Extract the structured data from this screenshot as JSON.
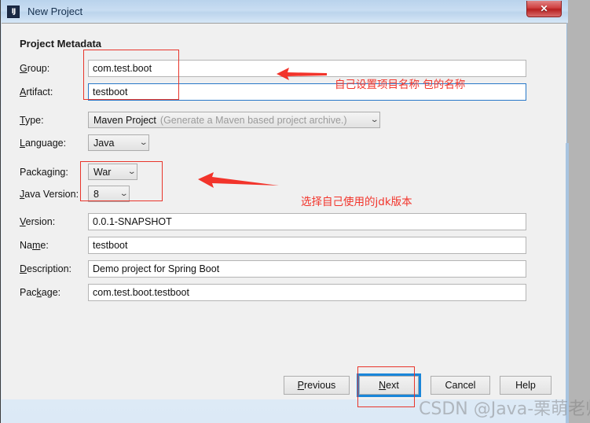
{
  "window": {
    "title": "New Project",
    "app_icon": "IJ",
    "close_label": "✕"
  },
  "dialog": {
    "section_title": "Project Metadata"
  },
  "fields": {
    "group": {
      "label_pre": "G",
      "label_mnemonic": "",
      "label": "Group:",
      "value": "com.test.boot"
    },
    "artifact": {
      "label": "Artifact:",
      "value": "testboot"
    },
    "type": {
      "label": "Type:",
      "value": "Maven Project",
      "hint": "(Generate a Maven based project archive.)"
    },
    "language": {
      "label": "Language:",
      "value": "Java"
    },
    "packaging": {
      "label": "Packaging:",
      "value": "War"
    },
    "java_version": {
      "label": "Java Version:",
      "value": "8"
    },
    "version": {
      "label": "Version:",
      "value": "0.0.1-SNAPSHOT"
    },
    "name": {
      "label": "Name:",
      "value": "testboot"
    },
    "description": {
      "label": "Description:",
      "value": "Demo project for Spring Boot"
    },
    "package": {
      "label": "Package:",
      "value": "com.test.boot.testboot"
    }
  },
  "annotations": {
    "note_top": "自己设置项目名称 包的名称",
    "note_jdk": "选择自己使用的jdk版本",
    "color": "#f2342b"
  },
  "buttons": {
    "previous": "Previous",
    "next": "Next",
    "cancel": "Cancel",
    "help": "Help"
  },
  "watermark": {
    "text": "CSDN @Java-栗萌老师"
  }
}
